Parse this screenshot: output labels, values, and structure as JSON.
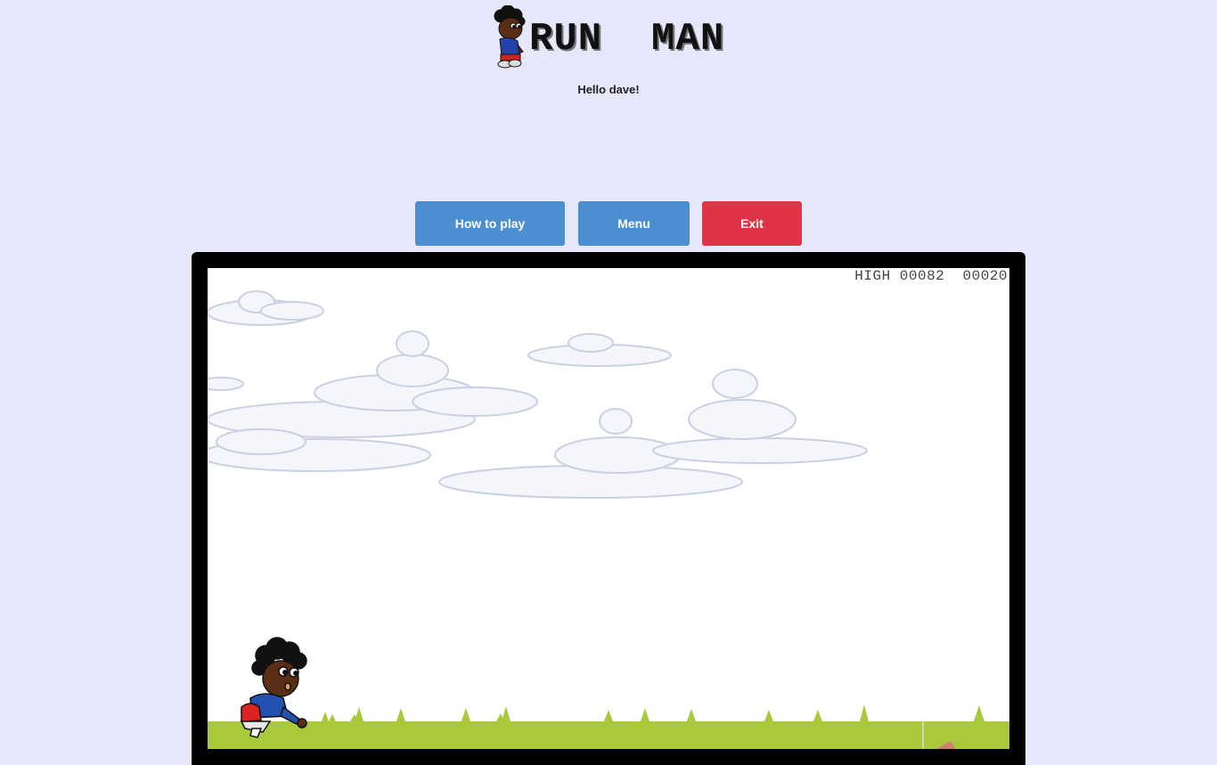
{
  "header": {
    "title": "RUN  MAN",
    "greeting": "Hello dave!"
  },
  "buttons": {
    "how_to_play": "How to play",
    "menu": "Menu",
    "exit": "Exit"
  },
  "game": {
    "scoreboard": "HIGH 00082  00020",
    "high_score": "00082",
    "current_score": "00020"
  },
  "colors": {
    "page_background": "#e6e7fb",
    "primary_button": "#4b8fd0",
    "danger_button": "#df3448",
    "ground": "#a9c93a",
    "sky": "#ffffff"
  },
  "icons": {
    "logo": "run-man-mascot-icon",
    "player": "runner-character-icon",
    "clouds": "cloud-icon",
    "grass": "grass-tuft-icon"
  }
}
